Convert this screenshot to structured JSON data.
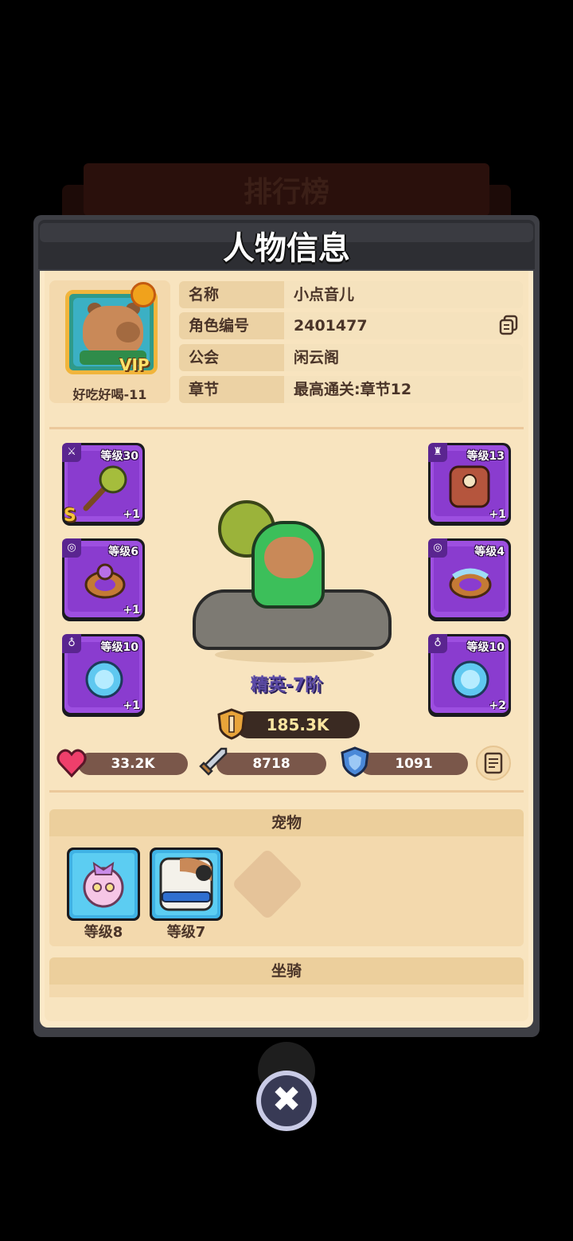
{
  "background": {
    "title": "排行榜"
  },
  "dialog": {
    "title": "人物信息",
    "close_icon": "close-icon"
  },
  "player": {
    "avatar_name": "好吃好喝-11",
    "vip_label": "VIP",
    "info": [
      {
        "label": "名称",
        "value": "小点音儿"
      },
      {
        "label": "角色编号",
        "value": "2401477"
      },
      {
        "label": "公会",
        "value": "闲云阁"
      },
      {
        "label": "章节",
        "value": "最高通关:章节12"
      }
    ]
  },
  "equipment": {
    "left": [
      {
        "slot": "weapon",
        "level": "等级30",
        "plus": "+1",
        "grade": "S",
        "icon": "mace-icon"
      },
      {
        "slot": "ring",
        "level": "等级6",
        "plus": "+1",
        "grade": "",
        "icon": "ring-icon"
      },
      {
        "slot": "necklace",
        "level": "等级10",
        "plus": "+1",
        "grade": "",
        "icon": "orb-icon"
      }
    ],
    "right": [
      {
        "slot": "armor",
        "level": "等级13",
        "plus": "+1",
        "grade": "",
        "icon": "armor-icon"
      },
      {
        "slot": "ring",
        "level": "等级4",
        "plus": "",
        "grade": "",
        "icon": "ring-icon"
      },
      {
        "slot": "necklace",
        "level": "等级10",
        "plus": "+2",
        "grade": "",
        "icon": "orb-icon"
      }
    ]
  },
  "character": {
    "rank": "精英-7阶"
  },
  "power": {
    "value": "185.3K"
  },
  "stats": {
    "hp": "33.2K",
    "attack": "8718",
    "defense": "1091"
  },
  "sections": {
    "pets": {
      "title": "宠物",
      "items": [
        {
          "level": "等级8",
          "icon": "pink-ghost-icon"
        },
        {
          "level": "等级7",
          "icon": "dog-icon"
        }
      ]
    },
    "mounts": {
      "title": "坐骑"
    }
  },
  "colors": {
    "panel_paper": "#f8e4bf",
    "slot_purple": "#9d4fe0",
    "pet_blue": "#3fb2e5",
    "rank_purple": "#5b4aa6"
  }
}
